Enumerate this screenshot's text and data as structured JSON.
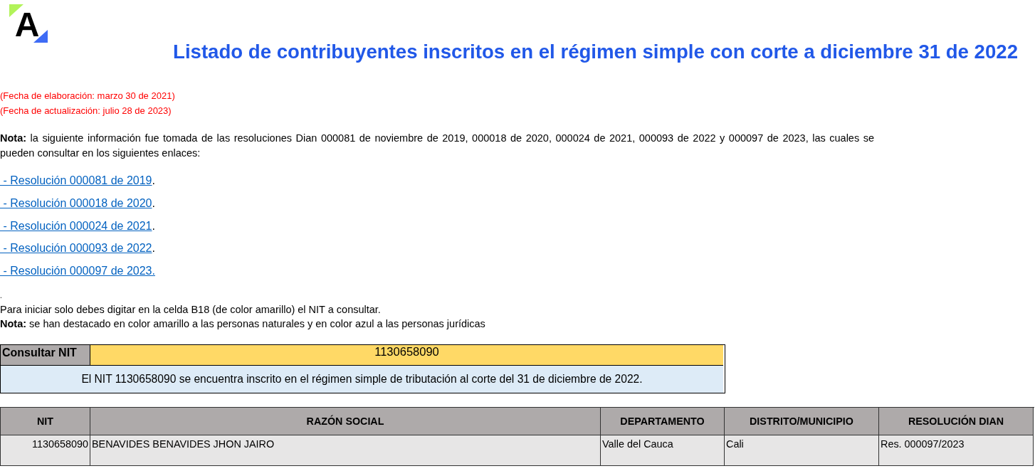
{
  "logo": {
    "letter": "A"
  },
  "title": "Listado de contribuyentes inscritos en el régimen simple con corte a diciembre 31 de 2022",
  "dates": [
    "(Fecha de elaboración: marzo 30 de 2021)",
    "(Fecha de actualización: julio 28 de 2023)"
  ],
  "intro_note": "**Nota:** la siguiente información fue tomada de las resoluciones Dian 000081 de noviembre de 2019, 000018 de 2020, 000024 de 2021, 000093 de 2022 y 000097 de 2023, las cuales se pueden consultar en los siguientes enlaces:",
  "links": [
    {
      "label": " - Resolución 000081 de 2019",
      "suffix": "."
    },
    {
      "label": " - Resolución 000018 de 2020",
      "suffix": "."
    },
    {
      "label": " - Resolución 000024 de 2021",
      "suffix": "."
    },
    {
      "label": " - Resolución 000093 de 2022",
      "suffix": "."
    },
    {
      "label": " - Resolución 000097 de 2023."
    }
  ],
  "separator_text": ".",
  "instructions": [
    "Para iniciar solo debes digitar en la celda B18 (de color amarillo) el NIT a consultar.",
    "**Nota:** se han destacado en color amarillo a las personas naturales y en color azul a las personas jurídicas"
  ],
  "lookup": {
    "label": "Consultar NIT",
    "value": "1130658090",
    "result": "El NIT 1130658090 se encuentra inscrito en el régimen simple de tributación al corte del 31 de diciembre de 2022."
  },
  "results_table": {
    "columns": [
      "NIT",
      "RAZÓN SOCIAL",
      "DEPARTAMENTO",
      "DISTRITO/MUNICIPIO",
      "RESOLUCIÓN DIAN"
    ],
    "rows": [
      [
        "1130658090",
        "BENAVIDES BENAVIDES JHON JAIRO",
        "Valle del Cauca",
        "Cali",
        "Res. 000097/2023"
      ]
    ]
  }
}
